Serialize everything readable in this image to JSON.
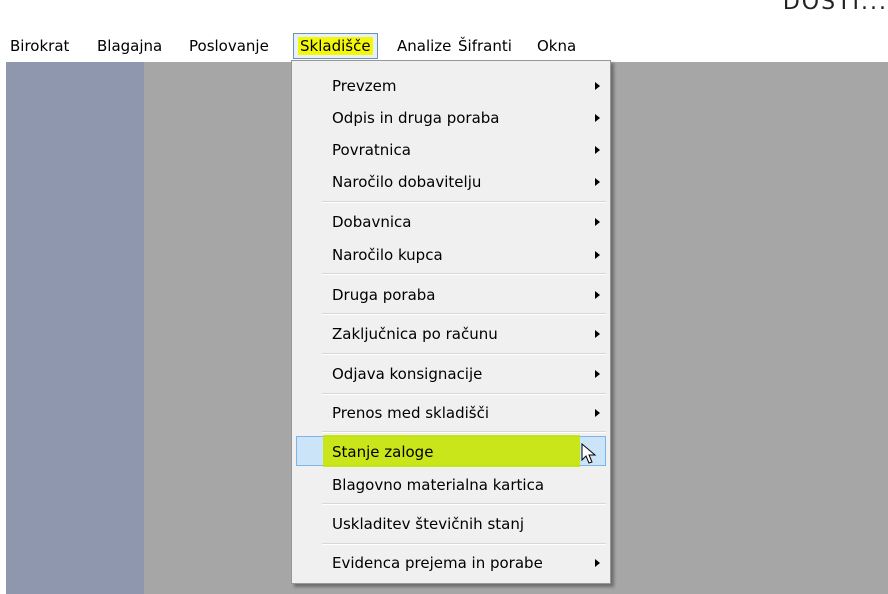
{
  "window": {
    "title_fragment": "DOSTI..."
  },
  "menubar": {
    "items": [
      {
        "label": "Birokrat",
        "underline": "B",
        "rest": "irokrat"
      },
      {
        "label": "Blagajna",
        "pre": "B",
        "underline": "l",
        "rest": "agajna"
      },
      {
        "label": "Poslovanje",
        "underline": "P",
        "rest": "oslovanje"
      },
      {
        "label": "Skladišče",
        "underline": "S",
        "rest": "kladišče"
      },
      {
        "label": "Analize"
      },
      {
        "label": "Šifranti",
        "pre": "Šifran",
        "underline": "t",
        "rest": "i"
      },
      {
        "label": "Okna"
      }
    ],
    "open_menu": "Skladišče"
  },
  "dropdown": {
    "items": [
      {
        "label": "Prevzem",
        "submenu": true
      },
      {
        "label": "Odpis in druga poraba",
        "submenu": true
      },
      {
        "label": "Povratnica",
        "submenu": true
      },
      {
        "label": "Naročilo dobavitelju",
        "submenu": true
      },
      {
        "label": "Dobavnica",
        "submenu": true
      },
      {
        "label": "Naročilo kupca",
        "submenu": true
      },
      {
        "label": "Druga poraba",
        "submenu": true
      },
      {
        "label": "Zaključnica po računu",
        "submenu": true
      },
      {
        "label": "Odjava konsignacije",
        "submenu": true
      },
      {
        "label": "Prenos med skladišči",
        "submenu": true
      },
      {
        "label": "Stanje zaloge",
        "submenu": false,
        "highlighted": true
      },
      {
        "label": "Blagovno materialna kartica",
        "submenu": false
      },
      {
        "label": "Uskladitev števičnih stanj",
        "submenu": false
      },
      {
        "label": "Evidenca prejema in porabe",
        "submenu": true
      }
    ]
  },
  "colors": {
    "highlight_marker": "#c8e600",
    "menu_hover": "#cce4f7",
    "workspace": "#a6a6a6",
    "sidebar": "#8e97ad"
  }
}
